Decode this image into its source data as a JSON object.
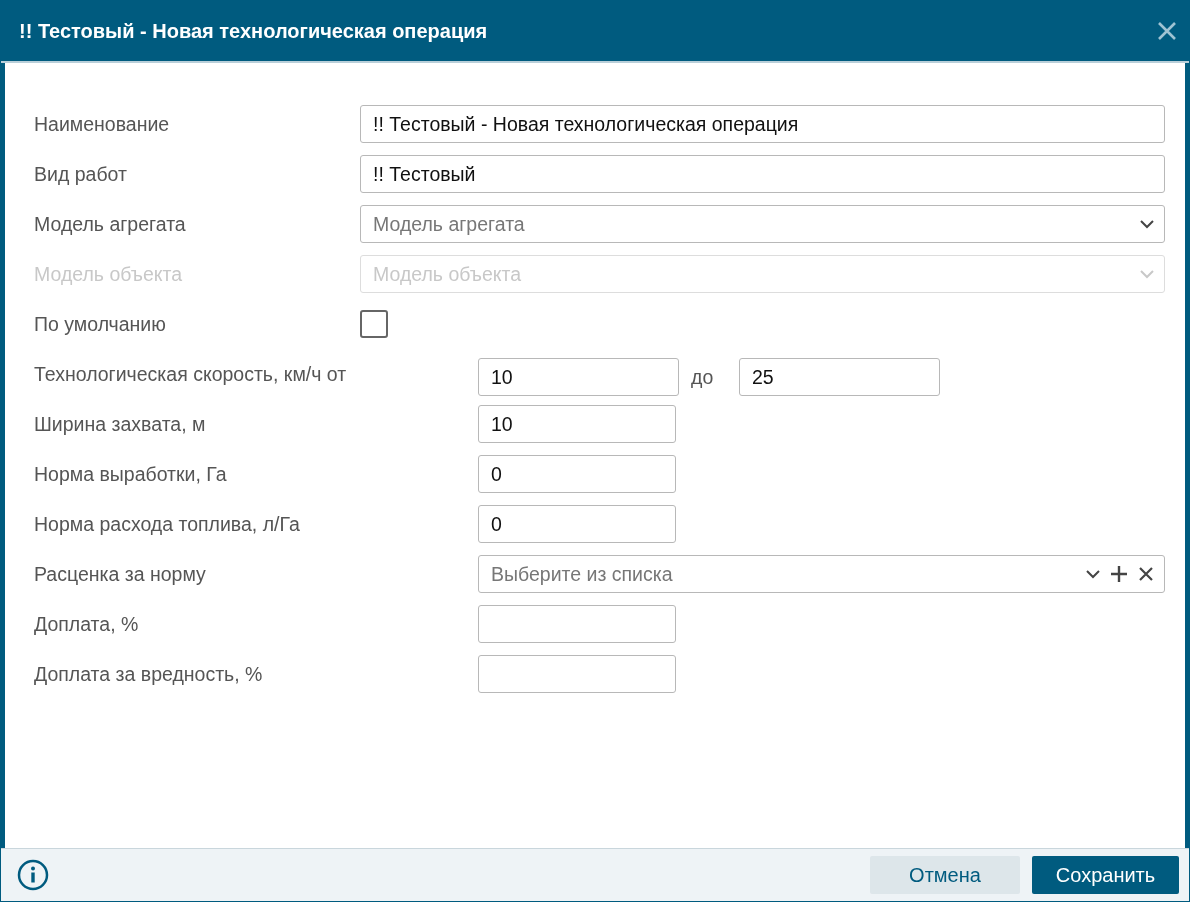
{
  "window": {
    "title": "!! Тестовый - Новая технологическая операция"
  },
  "fields": [
    {
      "kind": "wide_text",
      "label": "Наименование",
      "value": "!! Тестовый - Новая технологическая операция"
    },
    {
      "kind": "wide_text",
      "label": "Вид работ",
      "value": "!! Тестовый"
    },
    {
      "kind": "select",
      "label": "Модель агрегата",
      "placeholder": "Модель агрегата",
      "disabled": false
    },
    {
      "kind": "select",
      "label": "Модель объекта",
      "placeholder": "Модель объекта",
      "disabled": true
    },
    {
      "kind": "checkbox",
      "label": "По умолчанию",
      "checked": false
    },
    {
      "kind": "range",
      "label": "Технологическая скорость, км/ч от",
      "from": "10",
      "separator": "до",
      "to": "25"
    },
    {
      "kind": "short_text",
      "label": "Ширина захвата, м",
      "value": "10"
    },
    {
      "kind": "short_text",
      "label": "Норма выработки, Га",
      "value": "0"
    },
    {
      "kind": "short_text",
      "label": "Норма расхода топлива, л/Га",
      "value": "0"
    },
    {
      "kind": "combo",
      "label": "Расценка за норму",
      "placeholder": "Выберите из списка"
    },
    {
      "kind": "short_text",
      "label": "Доплата, %"
    },
    {
      "kind": "short_text",
      "label": "Доплата за вредность, %"
    }
  ],
  "buttons": [
    {
      "label": "Отмена",
      "kind": "secondary"
    },
    {
      "label": "Сохранить",
      "kind": "primary"
    }
  ]
}
